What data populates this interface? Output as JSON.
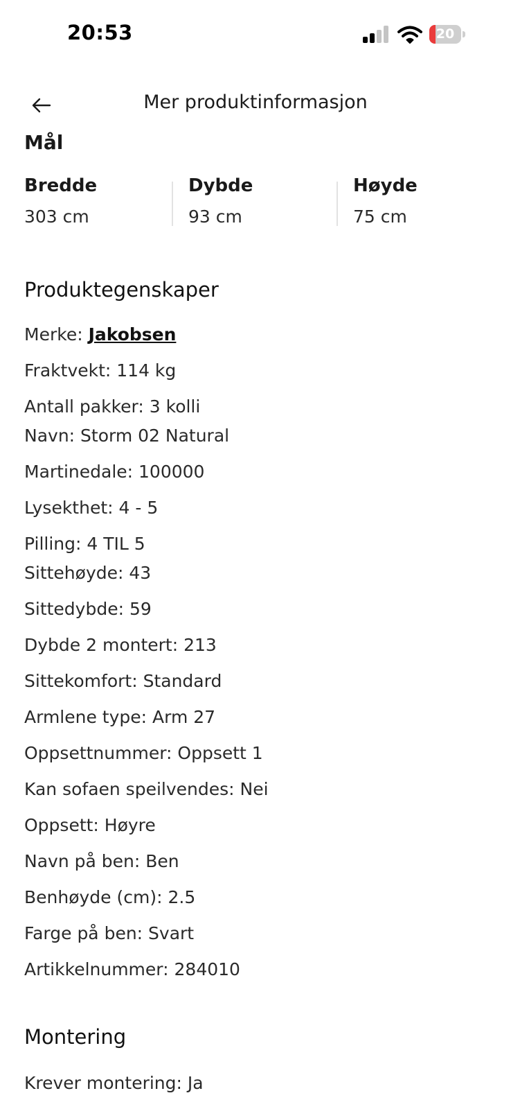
{
  "status_bar": {
    "time": "20:53",
    "battery_level": "20",
    "battery_color": "#ea3b3b"
  },
  "header": {
    "title": "Mer produktinformasjon",
    "back_icon": "arrow-left-icon"
  },
  "dimensions": {
    "section_title": "Mål",
    "items": [
      {
        "label": "Bredde",
        "value": "303 cm"
      },
      {
        "label": "Dybde",
        "value": "93 cm"
      },
      {
        "label": "Høyde",
        "value": "75 cm"
      }
    ]
  },
  "properties": {
    "title": "Produktegenskaper",
    "brand_label": "Merke: ",
    "brand_value": "Jakobsen",
    "items": [
      "Fraktvekt: 114 kg",
      "Antall pakker: 3 kolli",
      "Navn: Storm 02 Natural",
      "Martinedale: 100000",
      "Lysekthet: 4 - 5",
      "Pilling: 4 TIL 5",
      "Sittehøyde: 43",
      "Sittedybde: 59",
      "Dybde 2 montert: 213",
      "Sittekomfort: Standard",
      "Armlene type: Arm 27",
      "Oppsettnummer: Oppsett 1",
      "Kan sofaen speilvendes: Nei",
      "Oppsett: Høyre",
      "Navn på ben: Ben",
      "Benhøyde (cm): 2.5",
      "Farge på ben: Svart",
      "Artikkelnummer: 284010"
    ]
  },
  "assembly": {
    "title": "Montering",
    "items": [
      "Krever montering: Ja"
    ]
  }
}
